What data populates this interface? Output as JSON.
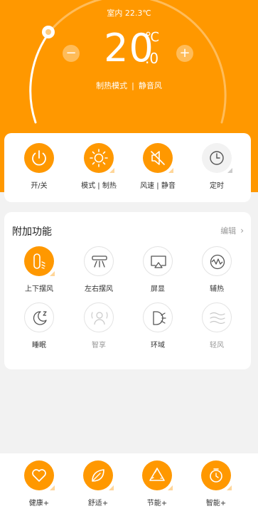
{
  "status": {
    "indoor_temp": "室内 22.3℃"
  },
  "thermostat": {
    "set_temp_int": "20",
    "set_temp_dec": ".0",
    "unit": "℃",
    "decrease_symbol": "−",
    "increase_symbol": "+",
    "mode": "制热模式",
    "separator": "|",
    "fan": "静音风"
  },
  "controls": [
    {
      "label": "开/关",
      "icon": "power-icon",
      "state": "on"
    },
    {
      "label": "模式 | 制热",
      "icon": "sun-icon",
      "state": "on"
    },
    {
      "label": "风速 | 静音",
      "icon": "speaker-mute-icon",
      "state": "on"
    },
    {
      "label": "定时",
      "icon": "clock-icon",
      "state": "off"
    }
  ],
  "extras": {
    "title": "附加功能",
    "edit_label": "编辑",
    "items": [
      {
        "label": "上下摆风",
        "icon": "vertical-swing-icon",
        "state": "on"
      },
      {
        "label": "左右摆风",
        "icon": "horizontal-swing-icon",
        "state": "off"
      },
      {
        "label": "屏显",
        "icon": "screen-display-icon",
        "state": "off"
      },
      {
        "label": "辅热",
        "icon": "aux-heat-icon",
        "state": "off"
      },
      {
        "label": "睡眠",
        "icon": "sleep-moon-icon",
        "state": "off"
      },
      {
        "label": "智享",
        "icon": "smart-share-icon",
        "state": "disabled"
      },
      {
        "label": "环域",
        "icon": "surround-icon",
        "state": "off"
      },
      {
        "label": "轻风",
        "icon": "gentle-breeze-icon",
        "state": "disabled"
      }
    ]
  },
  "bottom_nav": [
    {
      "label": "健康+",
      "icon": "heart-icon"
    },
    {
      "label": "舒适+",
      "icon": "leaf-icon"
    },
    {
      "label": "节能+",
      "icon": "recycle-icon"
    },
    {
      "label": "智能+",
      "icon": "smart-timer-icon"
    }
  ],
  "colors": {
    "accent": "#ff9800",
    "background": "#f2f2f2",
    "card": "#ffffff"
  }
}
